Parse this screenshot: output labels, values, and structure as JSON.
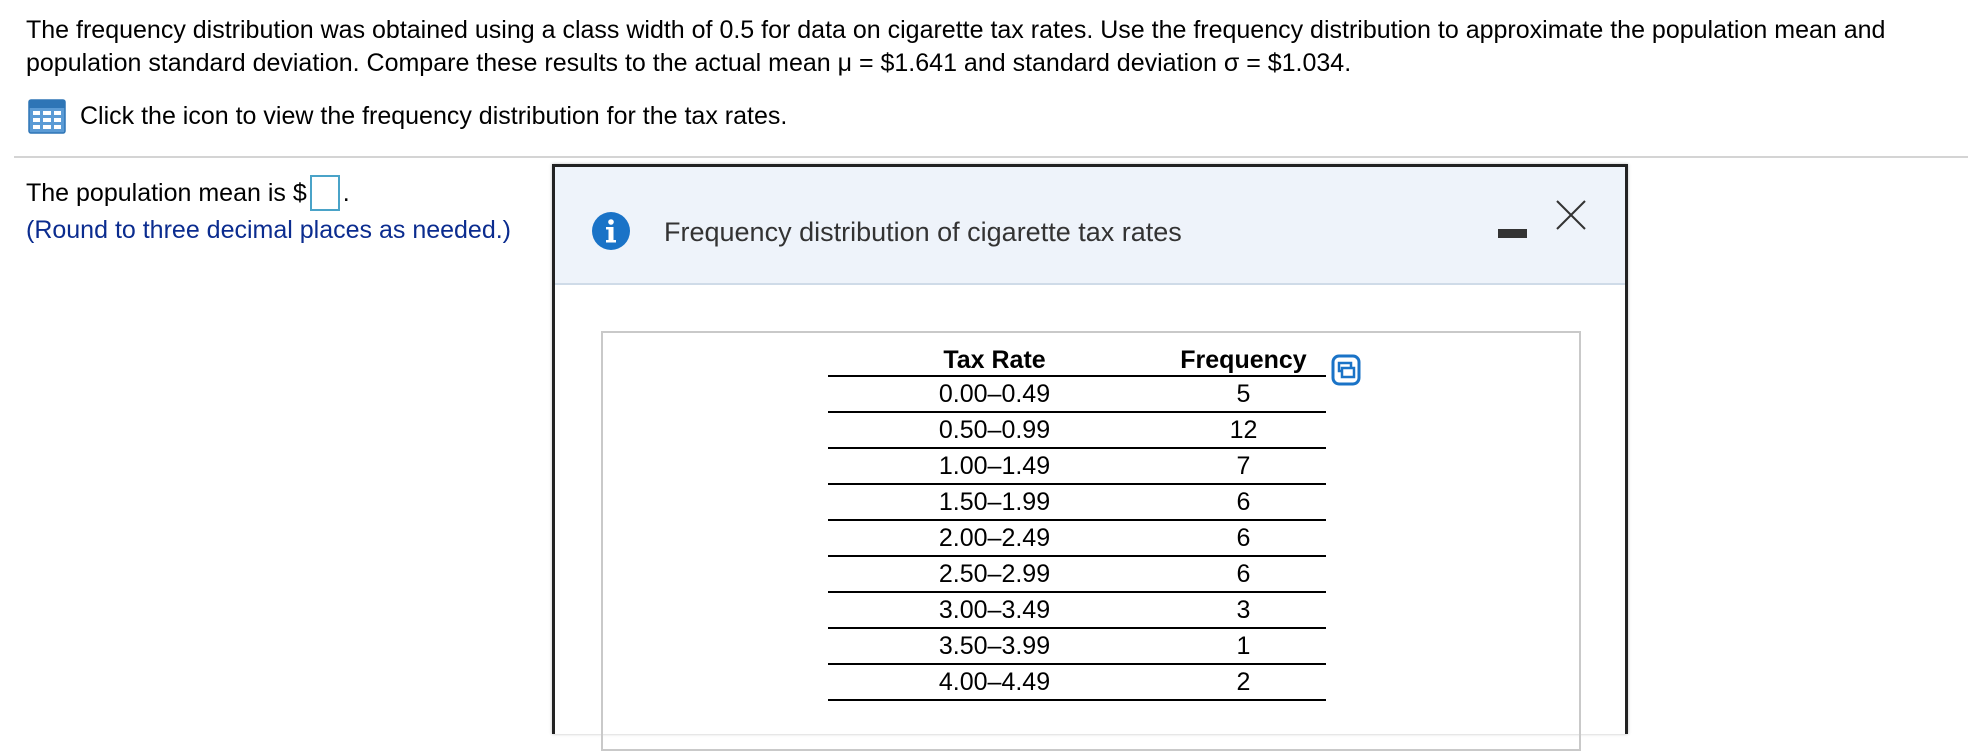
{
  "question": {
    "text": "The frequency distribution was obtained using a class width of 0.5 for data on cigarette tax rates. Use the frequency distribution to approximate the population mean and population standard deviation. Compare these results to the actual mean μ = $1.641 and standard deviation σ = $1.034."
  },
  "data_link": {
    "icon": "table-grid-icon",
    "text": "Click the icon to view the frequency distribution for the tax rates."
  },
  "answer": {
    "prefix": "The population mean is $",
    "value": "",
    "suffix": ".",
    "note": "(Round to three decimal places as needed.)"
  },
  "popup": {
    "title": "Frequency distribution of cigarette tax rates",
    "info_icon": "info-icon",
    "minimize_icon": "minimize-icon",
    "close_icon": "close-icon",
    "copy_icon": "copy-icon",
    "table": {
      "headers": [
        "Tax Rate",
        "Frequency"
      ],
      "rows": [
        {
          "rate": "0.00–0.49",
          "frequency": "5"
        },
        {
          "rate": "0.50–0.99",
          "frequency": "12"
        },
        {
          "rate": "1.00–1.49",
          "frequency": "7"
        },
        {
          "rate": "1.50–1.99",
          "frequency": "6"
        },
        {
          "rate": "2.00–2.49",
          "frequency": "6"
        },
        {
          "rate": "2.50–2.99",
          "frequency": "6"
        },
        {
          "rate": "3.00–3.49",
          "frequency": "3"
        },
        {
          "rate": "3.50–3.99",
          "frequency": "1"
        },
        {
          "rate": "4.00–4.49",
          "frequency": "2"
        }
      ]
    }
  },
  "colors": {
    "accent_blue": "#1a73c7",
    "note_blue": "#0b2c8f",
    "input_border": "#4aa3c8",
    "header_bg": "#eef3fa"
  }
}
